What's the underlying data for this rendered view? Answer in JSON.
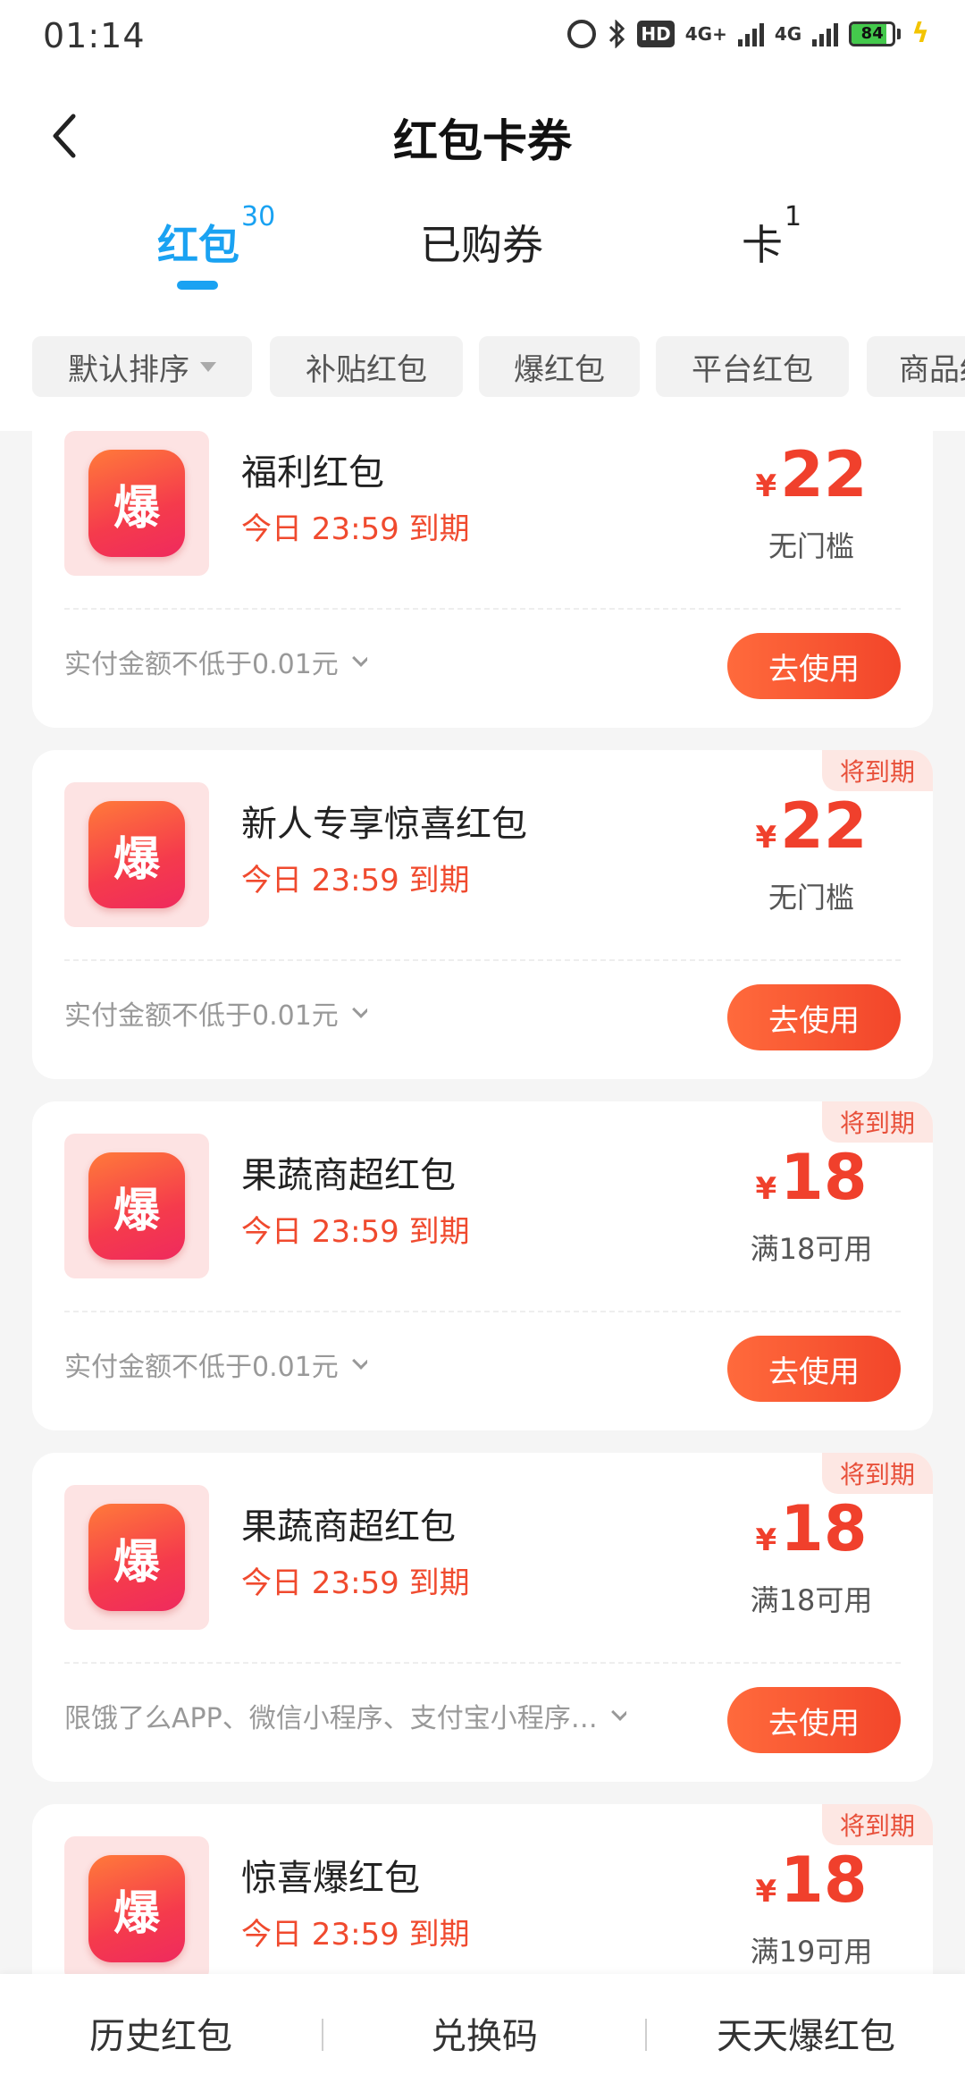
{
  "status": {
    "time": "01:14",
    "hd_label": "HD",
    "net1": "4G+",
    "net2": "4G",
    "battery_level": 84,
    "battery_text": "84"
  },
  "nav": {
    "title": "红包卡券"
  },
  "tabs": [
    {
      "label": "红包",
      "count": "30"
    },
    {
      "label": "已购券",
      "count": ""
    },
    {
      "label": "卡",
      "count": "1"
    }
  ],
  "filters": [
    "默认排序",
    "补贴红包",
    "爆红包",
    "平台红包",
    "商品红包"
  ],
  "logo_text": "爆",
  "cards": [
    {
      "title": "福利红包",
      "expire": "今日 23:59 到期",
      "yen": "¥",
      "amount": "22",
      "condition": "无门槛",
      "rule": "实付金额不低于0.01元",
      "button": "去使用",
      "badge": ""
    },
    {
      "title": "新人专享惊喜红包",
      "expire": "今日 23:59 到期",
      "yen": "¥",
      "amount": "22",
      "condition": "无门槛",
      "rule": "实付金额不低于0.01元",
      "button": "去使用",
      "badge": "将到期"
    },
    {
      "title": "果蔬商超红包",
      "expire": "今日 23:59 到期",
      "yen": "¥",
      "amount": "18",
      "condition": "满18可用",
      "rule": "实付金额不低于0.01元",
      "button": "去使用",
      "badge": "将到期"
    },
    {
      "title": "果蔬商超红包",
      "expire": "今日 23:59 到期",
      "yen": "¥",
      "amount": "18",
      "condition": "满18可用",
      "rule": "限饿了么APP、微信小程序、支付宝小程序…",
      "button": "去使用",
      "badge": "将到期"
    },
    {
      "title": "惊喜爆红包",
      "expire": "今日 23:59 到期",
      "yen": "¥",
      "amount": "18",
      "condition": "满19可用",
      "rule": "",
      "button": "",
      "badge": "将到期"
    }
  ],
  "bottom_bar": [
    "历史红包",
    "兑换码",
    "天天爆红包"
  ]
}
